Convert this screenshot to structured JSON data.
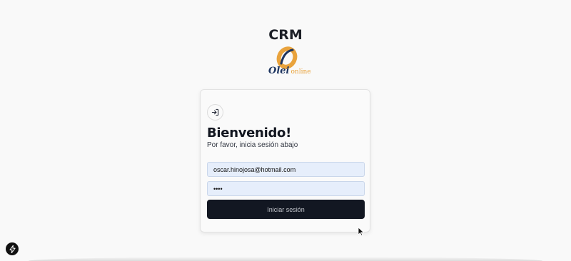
{
  "app": {
    "title": "CRM",
    "logo": {
      "icon": "olei-ring-logo",
      "text_main": "Olei",
      "text_sub": "online",
      "colors": {
        "navy": "#1e3560",
        "orange": "#e9a33d"
      }
    }
  },
  "login": {
    "icon": "sign-in-icon",
    "heading": "Bienvenido!",
    "subtitle": "Por favor, inicia sesión abajo",
    "email": {
      "value": "oscar.hinojosa@hotmail.com"
    },
    "password": {
      "value": "••••"
    },
    "submit_label": "Iniciar sesión"
  },
  "dev_badge": {
    "icon": "lightning-icon"
  },
  "colors": {
    "page_bg": "#f9f9f9",
    "input_bg": "#e6eefb",
    "button_bg": "#121722",
    "heading": "#121620"
  }
}
